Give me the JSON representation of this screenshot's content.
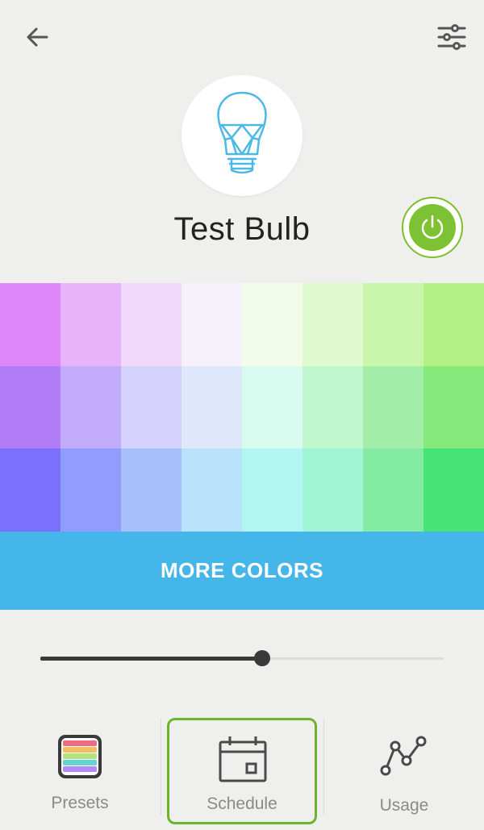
{
  "header": {
    "back_icon": "arrow-left-icon",
    "settings_icon": "sliders-icon"
  },
  "device": {
    "name": "Test Bulb",
    "icon": "lightbulb-icon",
    "power_icon": "power-icon",
    "power_on": true
  },
  "palette": {
    "colors": [
      [
        "#dd87fb",
        "#e7b3fb",
        "#f2d9fb",
        "#f7f1fb",
        "#f3fceb",
        "#e0fad0",
        "#c9f6aa",
        "#b3f184"
      ],
      [
        "#b07df7",
        "#c2acfa",
        "#d4d2fb",
        "#dfe8fb",
        "#d8fbf0",
        "#c0f7cf",
        "#a2eea9",
        "#86e97c"
      ],
      [
        "#7a70fd",
        "#909dfc",
        "#a7bffb",
        "#b8e3fa",
        "#b3f5f2",
        "#a0f5d6",
        "#84eba2",
        "#46e376"
      ]
    ]
  },
  "more_colors_label": "MORE COLORS",
  "brightness": {
    "level_percent": 55
  },
  "nav": {
    "presets_label": "Presets",
    "schedule_label": "Schedule",
    "usage_label": "Usage",
    "presets_icon": "rainbow-palette-icon",
    "schedule_icon": "calendar-icon",
    "usage_icon": "line-graph-icon"
  },
  "colors": {
    "accent_green": "#7cc233",
    "accent_blue": "#44b6ea",
    "highlight_border": "#6cb52a"
  }
}
